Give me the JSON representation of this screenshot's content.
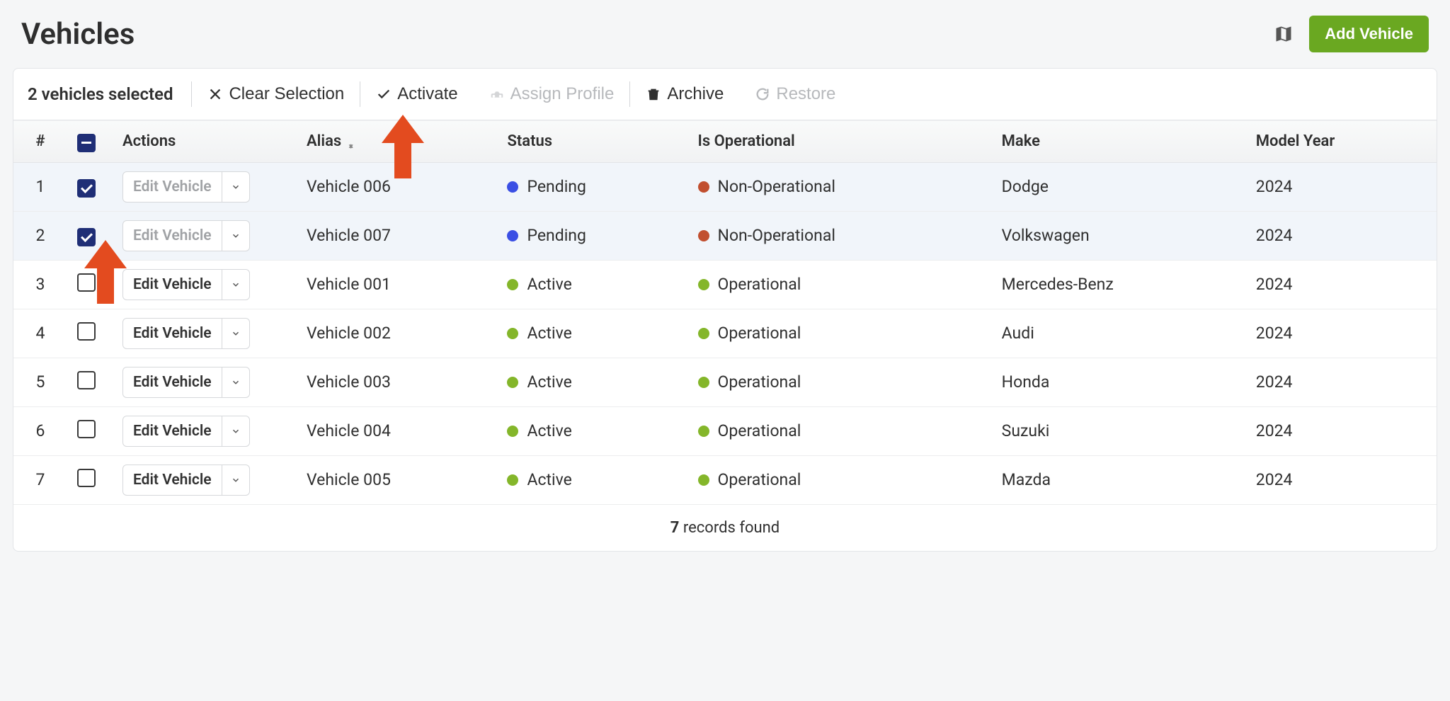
{
  "header": {
    "title": "Vehicles",
    "add_button": "Add Vehicle"
  },
  "toolbar": {
    "selected": "2 vehicles selected",
    "clear": "Clear Selection",
    "activate": "Activate",
    "assign": "Assign Profile",
    "archive": "Archive",
    "restore": "Restore"
  },
  "columns": {
    "num": "#",
    "actions": "Actions",
    "alias": "Alias",
    "status": "Status",
    "operational": "Is Operational",
    "make": "Make",
    "year": "Model Year"
  },
  "edit_label": "Edit Vehicle",
  "rows": [
    {
      "num": "1",
      "checked": true,
      "muted": true,
      "alias": "Vehicle 006",
      "status": "Pending",
      "status_color": "blue",
      "op": "Non-Operational",
      "op_color": "red",
      "make": "Dodge",
      "year": "2024"
    },
    {
      "num": "2",
      "checked": true,
      "muted": true,
      "alias": "Vehicle 007",
      "status": "Pending",
      "status_color": "blue",
      "op": "Non-Operational",
      "op_color": "red",
      "make": "Volkswagen",
      "year": "2024"
    },
    {
      "num": "3",
      "checked": false,
      "muted": false,
      "alias": "Vehicle 001",
      "status": "Active",
      "status_color": "green",
      "op": "Operational",
      "op_color": "green",
      "make": "Mercedes-Benz",
      "year": "2024"
    },
    {
      "num": "4",
      "checked": false,
      "muted": false,
      "alias": "Vehicle 002",
      "status": "Active",
      "status_color": "green",
      "op": "Operational",
      "op_color": "green",
      "make": "Audi",
      "year": "2024"
    },
    {
      "num": "5",
      "checked": false,
      "muted": false,
      "alias": "Vehicle 003",
      "status": "Active",
      "status_color": "green",
      "op": "Operational",
      "op_color": "green",
      "make": "Honda",
      "year": "2024"
    },
    {
      "num": "6",
      "checked": false,
      "muted": false,
      "alias": "Vehicle 004",
      "status": "Active",
      "status_color": "green",
      "op": "Operational",
      "op_color": "green",
      "make": "Suzuki",
      "year": "2024"
    },
    {
      "num": "7",
      "checked": false,
      "muted": false,
      "alias": "Vehicle 005",
      "status": "Active",
      "status_color": "green",
      "op": "Operational",
      "op_color": "green",
      "make": "Mazda",
      "year": "2024"
    }
  ],
  "footer": {
    "count": "7",
    "label": " records found"
  },
  "colors": {
    "accent": "#6aa821",
    "selection_bg": "#f1f5fa",
    "check_bg": "#1f2e76"
  }
}
